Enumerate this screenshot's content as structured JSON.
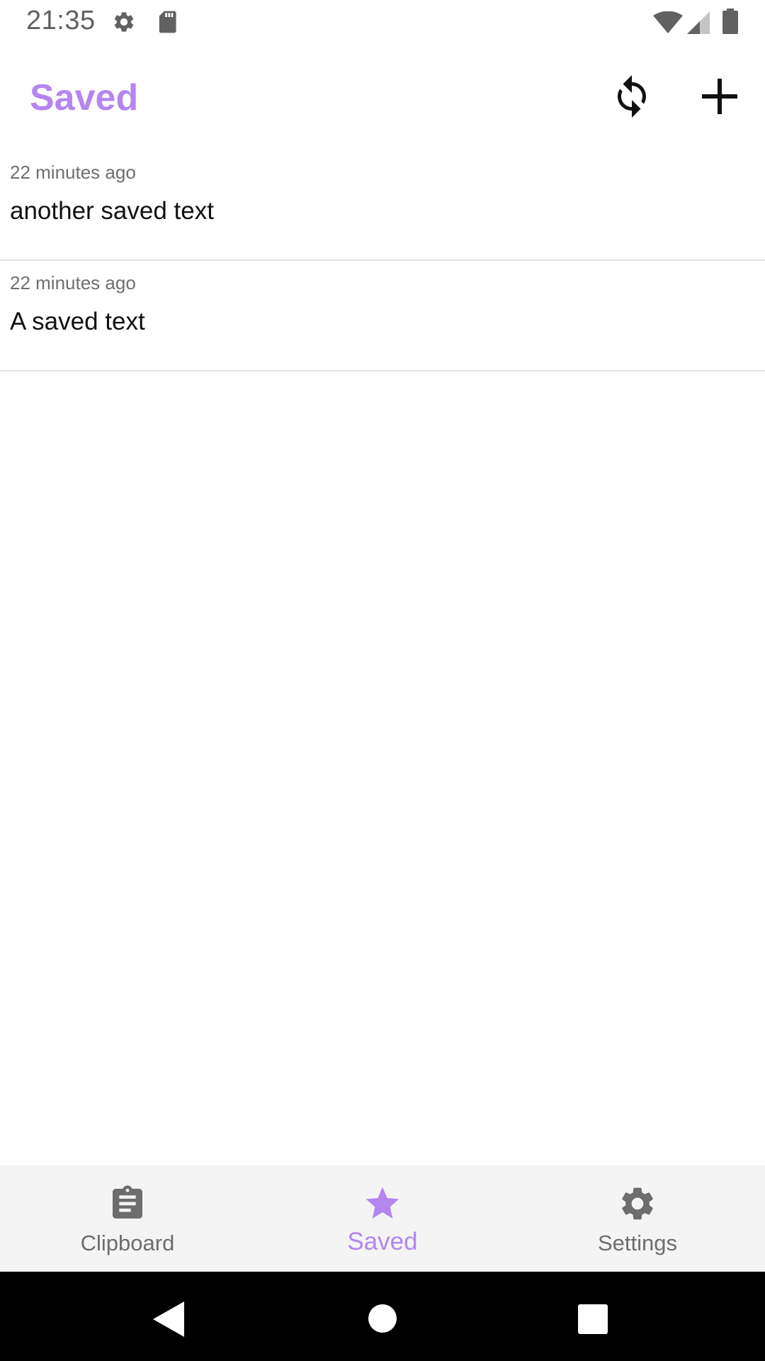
{
  "status_bar": {
    "time": "21:35",
    "icons": [
      "settings-icon",
      "sd-card-icon",
      "wifi-icon",
      "signal-icon",
      "battery-icon"
    ]
  },
  "app_bar": {
    "title": "Saved",
    "actions": [
      "refresh-icon",
      "add-icon"
    ]
  },
  "saved_items": [
    {
      "time": "22 minutes ago",
      "text": "another saved text"
    },
    {
      "time": "22 minutes ago",
      "text": "A saved text"
    }
  ],
  "bottom_nav": {
    "items": [
      {
        "label": "Clipboard",
        "icon": "clipboard-icon",
        "active": false
      },
      {
        "label": "Saved",
        "icon": "star-icon",
        "active": true
      },
      {
        "label": "Settings",
        "icon": "gear-icon",
        "active": false
      }
    ]
  },
  "colors": {
    "accent": "#b386f0",
    "nav_background": "#f4f4f4",
    "divider": "#e3e3e3"
  }
}
